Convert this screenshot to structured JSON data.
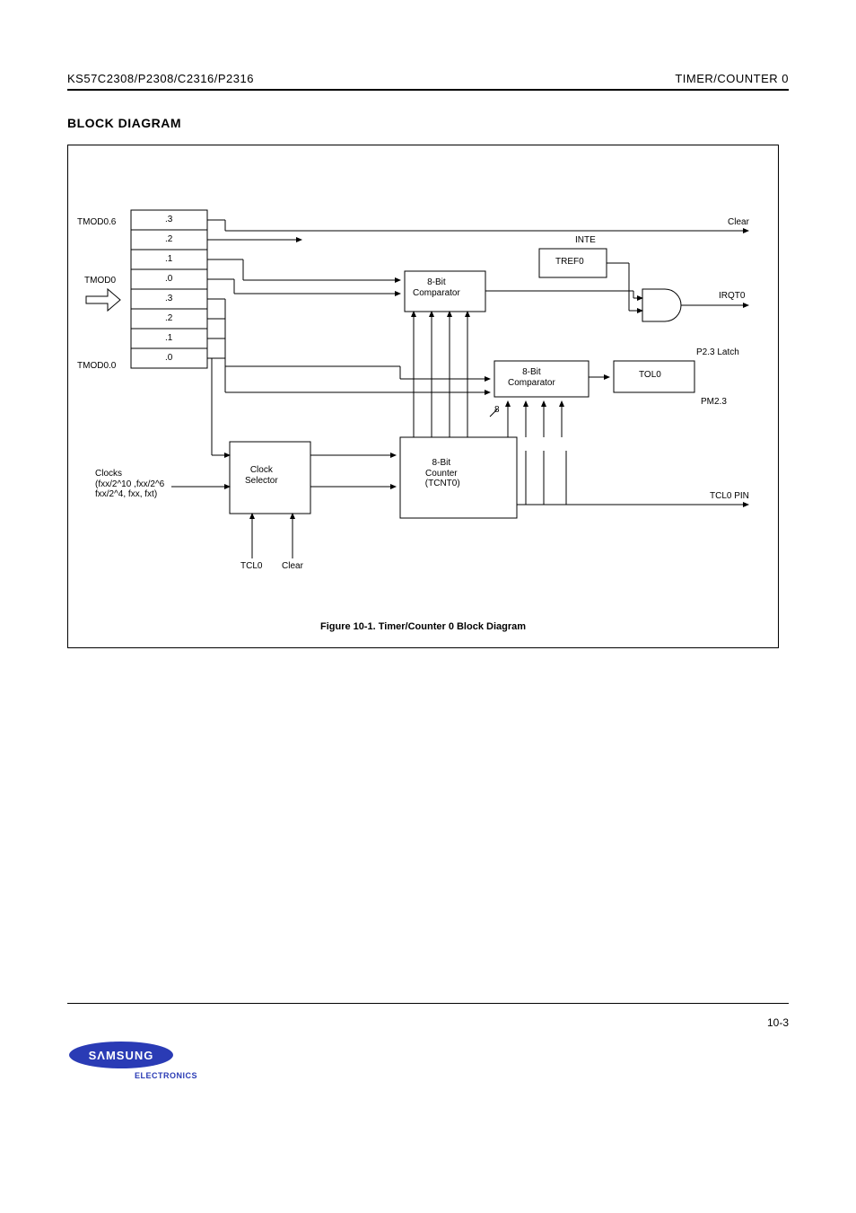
{
  "header": {
    "left": "KS57C2308/P2308/C2316/P2316",
    "right": "TIMER/COUNTER 0"
  },
  "section_title": "BLOCK DIAGRAM",
  "registers": [
    ".3",
    ".2",
    ".1",
    ".0",
    ".3",
    ".2",
    ".1",
    ".0"
  ],
  "label_tmod0_hi": "TMOD0.6",
  "label_tmod0_lo": "TMOD0.0",
  "label_tmod0_left": "TMOD0",
  "label_clocks": "Clocks\n(fxx/2^10 ,fxx/2^6\nfxx/2^4, fxx, fxt)",
  "block_clock_sel": "Clock\nSelector",
  "clock_sel_in_left": "TCL0",
  "clock_sel_in_right": "Clear",
  "block_counter": "8-Bit\nCounter\n (TCNT0)",
  "block_comp": "8-Bit\nComparator",
  "block_tref0": "TREF0",
  "block_tol0": "TOL0",
  "label_inte": "INTE",
  "output_clear": "Clear",
  "output_irqt0": "IRQT0",
  "output_tcl0": "TCL0 PIN",
  "output_p23": "P2.3 Latch",
  "output_pm23": "PM2.3",
  "label_8": "8",
  "figure_caption": "Figure 10-1.  Timer/Counter 0  Block Diagram",
  "page_number": "10-3"
}
